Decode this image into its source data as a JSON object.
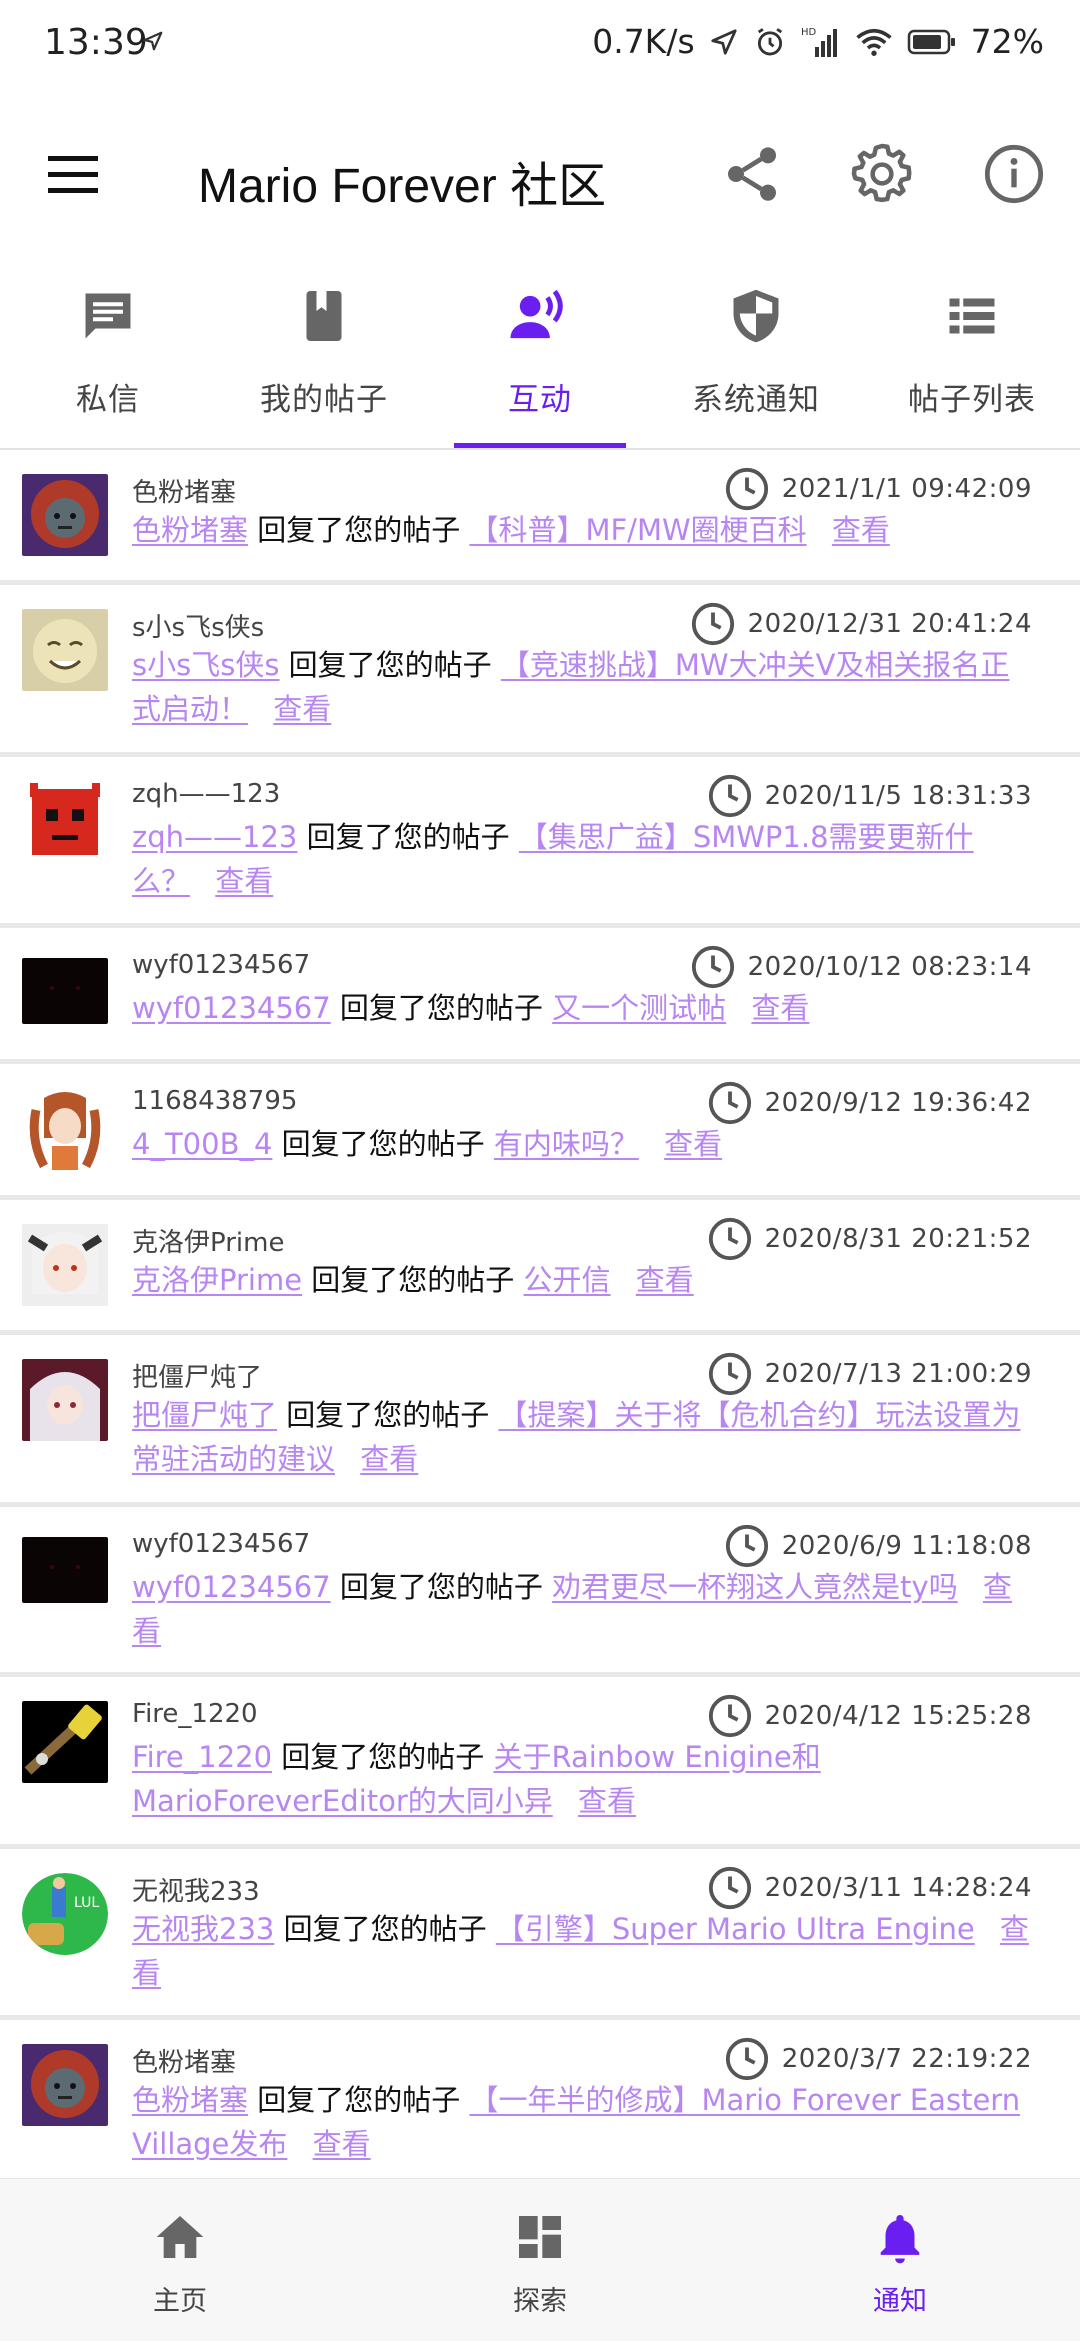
{
  "status_bar": {
    "time": "13:39",
    "net_speed": "0.7K/s",
    "battery": "72%",
    "hd_label": "HD"
  },
  "app_bar": {
    "title": "Mario Forever 社区",
    "menu_icon": "menu-icon",
    "share_icon": "share-icon",
    "settings_icon": "gear-icon",
    "info_icon": "info-icon"
  },
  "tabs": [
    {
      "label": "私信",
      "icon": "message-icon",
      "active": false
    },
    {
      "label": "我的帖子",
      "icon": "book-icon",
      "active": false
    },
    {
      "label": "互动",
      "icon": "person-voice-icon",
      "active": true
    },
    {
      "label": "系统通知",
      "icon": "shield-icon",
      "active": false
    },
    {
      "label": "帖子列表",
      "icon": "list-icon",
      "active": false
    }
  ],
  "accent_color": "#6a1ff0",
  "link_color": "#b886f2",
  "notifications": [
    {
      "user": "色粉堵塞",
      "time": "2021/1/1 09:42:09",
      "actor": "色粉堵塞",
      "action": "回复了您的帖子",
      "post": "【科普】MF/MW圈梗百科",
      "view": "查看"
    },
    {
      "user": "s小s飞s侠s",
      "time": "2020/12/31 20:41:24",
      "actor": "s小s飞s侠s",
      "action": "回复了您的帖子",
      "post": "【竞速挑战】MW大冲关V及相关报名正式启动！",
      "view": "查看"
    },
    {
      "user": "zqh——123",
      "time": "2020/11/5 18:31:33",
      "actor": "zqh——123",
      "action": "回复了您的帖子",
      "post": "【集思广益】SMWP1.8需要更新什么？",
      "view": "查看"
    },
    {
      "user": "wyf01234567",
      "time": "2020/10/12 08:23:14",
      "actor": "wyf01234567",
      "action": "回复了您的帖子",
      "post": "又一个测试帖",
      "view": "查看"
    },
    {
      "user": "1168438795",
      "time": "2020/9/12 19:36:42",
      "actor": "4_T00B_4",
      "action": "回复了您的帖子",
      "post": "有内味吗？",
      "view": "查看"
    },
    {
      "user": "克洛伊Prime",
      "time": "2020/8/31 20:21:52",
      "actor": "克洛伊Prime",
      "action": "回复了您的帖子",
      "post": "公开信",
      "view": "查看"
    },
    {
      "user": "把僵尸炖了",
      "time": "2020/7/13 21:00:29",
      "actor": "把僵尸炖了",
      "action": "回复了您的帖子",
      "post": "【提案】关于将【危机合约】玩法设置为常驻活动的建议",
      "view": "查看"
    },
    {
      "user": "wyf01234567",
      "time": "2020/6/9 11:18:08",
      "actor": "wyf01234567",
      "action": "回复了您的帖子",
      "post": "劝君更尽一杯翔这人竟然是ty吗",
      "view": "查看"
    },
    {
      "user": "Fire_1220",
      "time": "2020/4/12 15:25:28",
      "actor": "Fire_1220",
      "action": "回复了您的帖子",
      "post": "关于Rainbow Enigine和MarioForeverEditor的大同小异",
      "view": "查看"
    },
    {
      "user": "无视我233",
      "time": "2020/3/11 14:28:24",
      "actor": "无视我233",
      "action": "回复了您的帖子",
      "post": "【引擎】Super Mario Ultra Engine",
      "view": "查看"
    },
    {
      "user": "色粉堵塞",
      "time": "2020/3/7 22:19:22",
      "actor": "色粉堵塞",
      "action": "回复了您的帖子",
      "post": "【一年半的修成】Mario Forever Eastern Village发布",
      "view": "查看"
    }
  ],
  "bottom_nav": [
    {
      "label": "主页",
      "icon": "home-icon",
      "active": false
    },
    {
      "label": "探索",
      "icon": "dashboard-icon",
      "active": false
    },
    {
      "label": "通知",
      "icon": "bell-icon",
      "active": true
    }
  ]
}
